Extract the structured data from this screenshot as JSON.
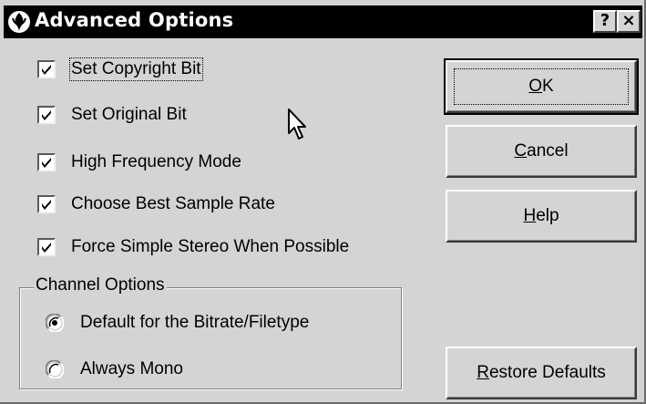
{
  "window": {
    "title": "Advanced Options",
    "help_button": "?",
    "close_button": "×"
  },
  "options": [
    {
      "label": "Set Copyright Bit",
      "checked": true
    },
    {
      "label": "Set Original Bit",
      "checked": true
    },
    {
      "label": "High Frequency Mode",
      "checked": true
    },
    {
      "label": "Choose Best Sample Rate",
      "checked": true
    },
    {
      "label": "Force Simple Stereo When Possible",
      "checked": true
    }
  ],
  "channel_options": {
    "title": "Channel Options",
    "choices": [
      {
        "label": "Default for the Bitrate/Filetype",
        "selected": true
      },
      {
        "label": "Always Mono",
        "selected": false
      }
    ]
  },
  "buttons": {
    "ok": {
      "mnemonic": "O",
      "rest": "K"
    },
    "cancel": {
      "mnemonic": "C",
      "rest": "ancel"
    },
    "help": {
      "mnemonic": "H",
      "rest": "elp"
    },
    "restore": {
      "mnemonic": "R",
      "rest": "estore Defaults"
    }
  },
  "icons": {
    "app": "app-icon",
    "check": "check-icon",
    "cursor": "mouse-pointer-icon"
  }
}
